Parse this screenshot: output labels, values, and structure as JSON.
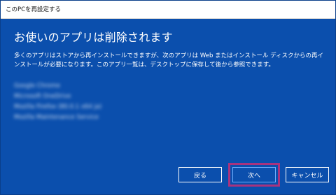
{
  "window": {
    "title": "このPCを再設定する"
  },
  "main": {
    "heading": "お使いのアプリは削除されます",
    "description": "多くのアプリはストアから再インストールできますが、次のアプリは Web またはインストール ディスクからの再インストールが必要になります。このアプリ一覧は、デスクトップに保存して後から参照できます。",
    "apps": [
      "Google Chrome",
      "Microsoft OneDrive",
      "Mozilla Firefox (80.0.1 x64 ja)",
      "Mozilla Maintenance Service"
    ]
  },
  "buttons": {
    "back": "戻る",
    "next": "次へ",
    "cancel": "キャンセル"
  },
  "colors": {
    "background": "#0b4fad",
    "highlight": "#a8337e"
  }
}
